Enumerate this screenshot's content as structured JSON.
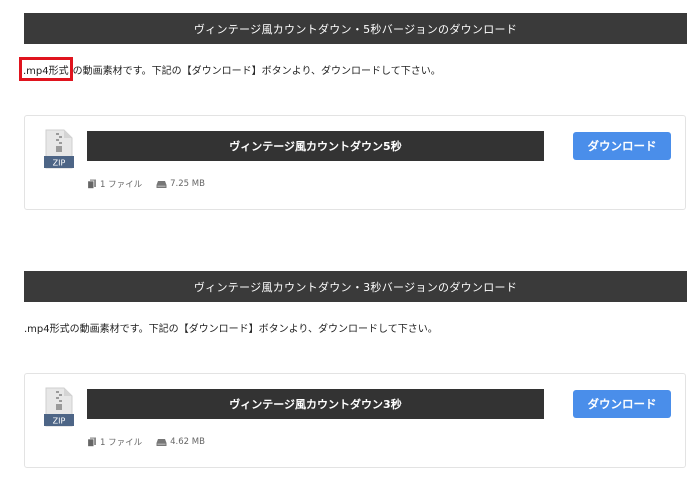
{
  "sections": [
    {
      "header": "ヴィンテージ風カウントダウン・5秒バージョンのダウンロード",
      "desc_highlight": ".mp4形式",
      "desc_rest": "の動画素材です。下記の【ダウンロード】ボタンより、ダウンロードして下さい。",
      "file": {
        "icon_label": "ZIP",
        "title": "ヴィンテージ風カウントダウン5秒",
        "button": "ダウンロード",
        "file_count": "1 ファイル",
        "size": "7.25 MB"
      }
    },
    {
      "header": "ヴィンテージ風カウントダウン・3秒バージョンのダウンロード",
      "desc": ".mp4形式の動画素材です。下記の【ダウンロード】ボタンより、ダウンロードして下さい。",
      "file": {
        "icon_label": "ZIP",
        "title": "ヴィンテージ風カウントダウン3秒",
        "button": "ダウンロード",
        "file_count": "1 ファイル",
        "size": "4.62 MB"
      }
    }
  ],
  "colors": {
    "header_bg": "#3a3a3a",
    "title_bg": "#333333",
    "button_bg": "#4a8eea",
    "highlight_border": "#e0141e",
    "zip_badge": "#4d6586"
  }
}
